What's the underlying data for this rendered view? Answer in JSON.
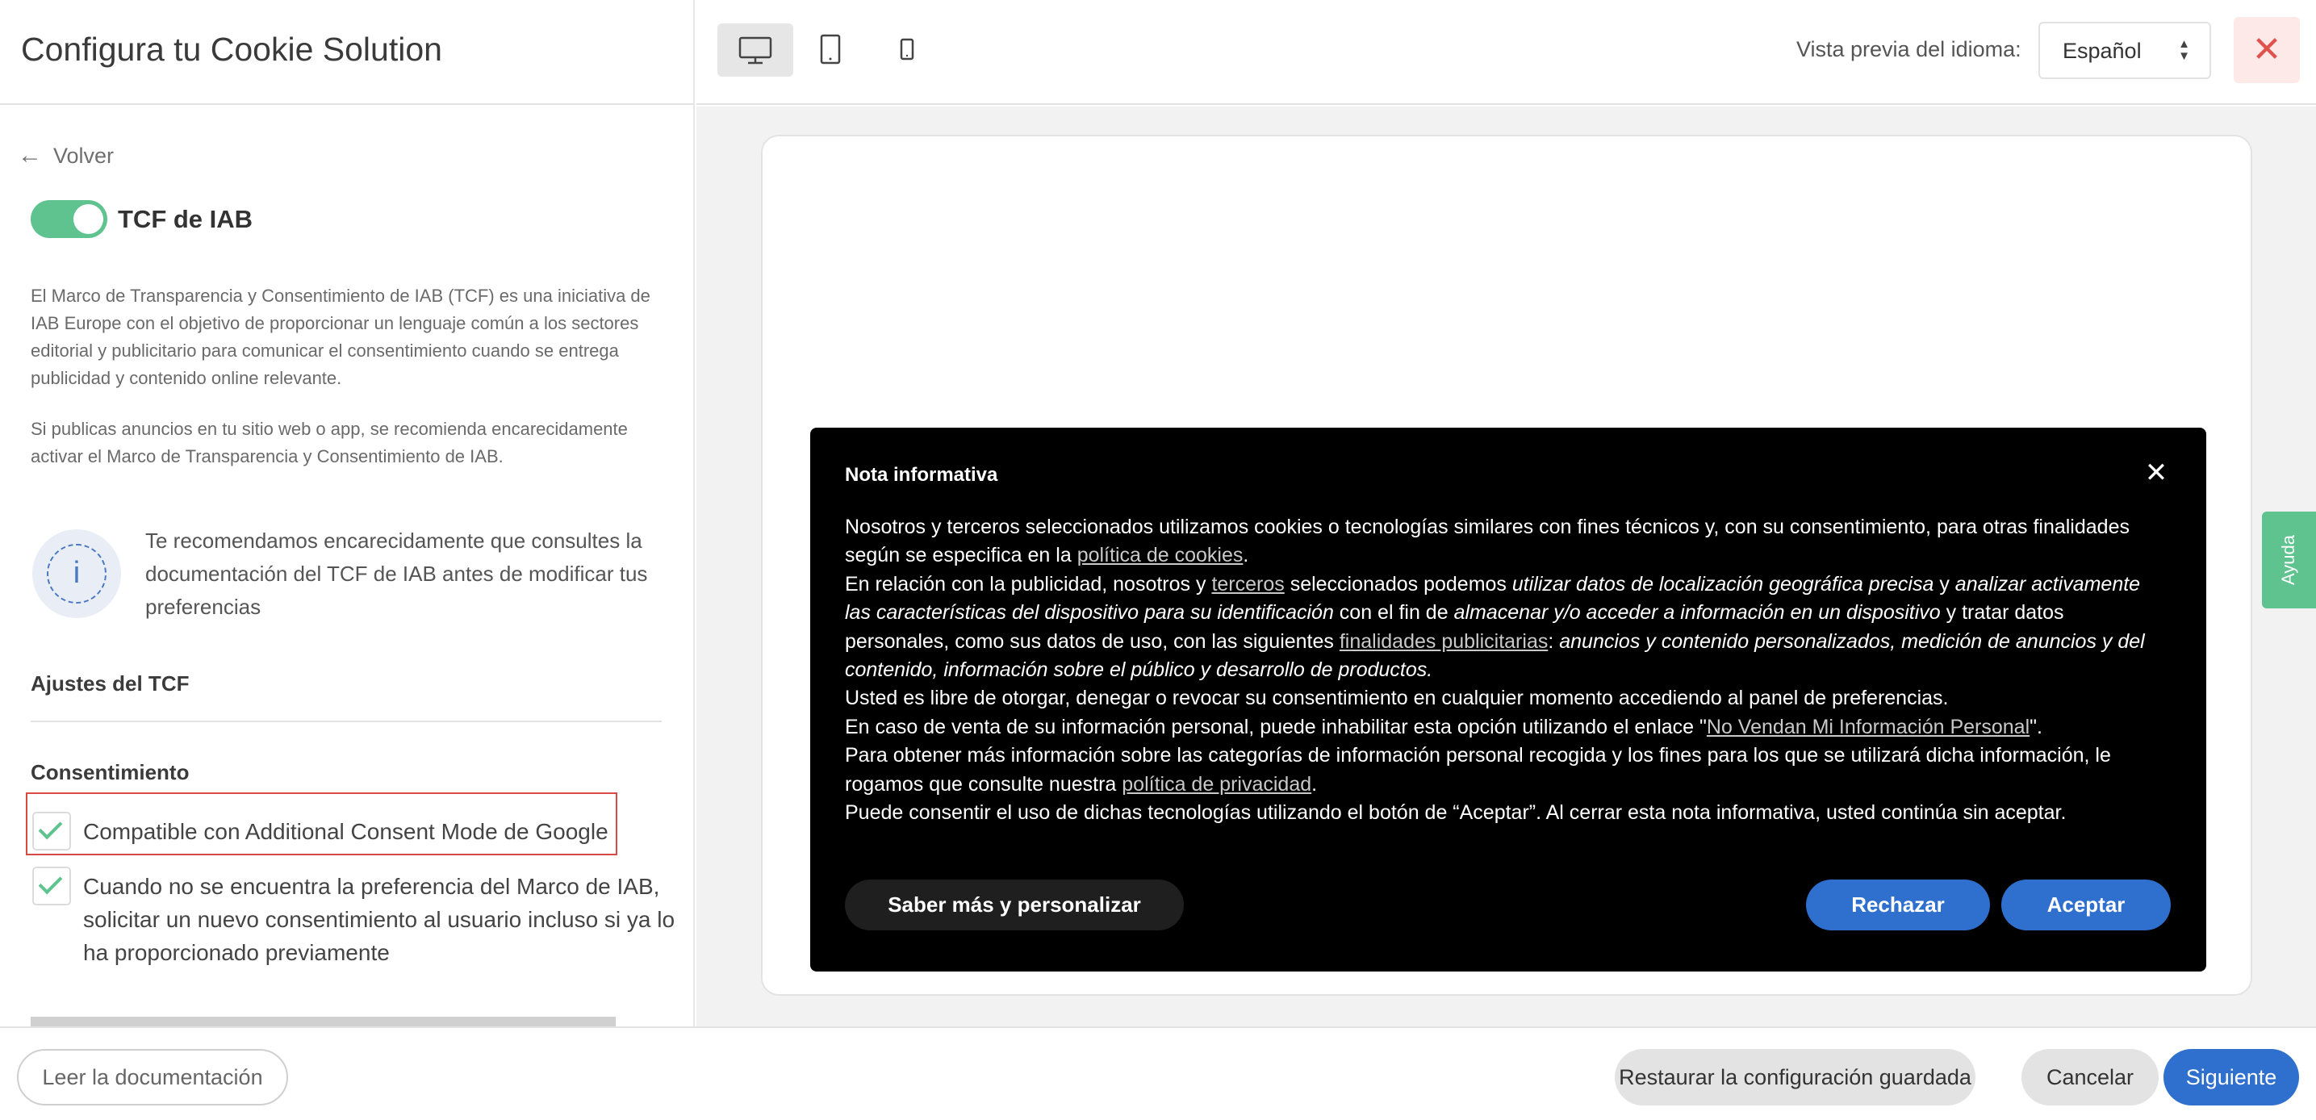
{
  "header": {
    "title": "Configura tu Cookie Solution"
  },
  "sidebar": {
    "back_label": "Volver",
    "tcf_toggle": {
      "on": true,
      "label": "TCF de IAB"
    },
    "description_1": "El Marco de Transparencia y Consentimiento de IAB (TCF) es una iniciativa de IAB Europe con el objetivo de proporcionar un lenguaje común a los sectores editorial y publicitario para comunicar el consentimiento cuando se entrega publicidad y contenido online relevante.",
    "description_2": "Si publicas anuncios en tu sitio web o app, se recomienda encarecidamente activar el Marco de Transparencia y Consentimiento de IAB.",
    "info_text": "Te recomendamos encarecidamente que consultes la documentación del TCF de IAB antes de modificar tus preferencias",
    "settings_heading": "Ajustes del TCF",
    "consent_heading": "Consentimiento",
    "checkboxes": [
      {
        "label": "Compatible con Additional Consent Mode de Google",
        "checked": true
      },
      {
        "label": "Cuando no se encuentra la preferencia del Marco de IAB, solicitar un nuevo consentimiento al usuario incluso si ya lo ha proporcionado previamente",
        "checked": true
      }
    ]
  },
  "toolbar": {
    "devices": [
      "desktop",
      "tablet",
      "mobile"
    ],
    "active_device": "desktop",
    "language_label": "Vista previa del idioma:",
    "language_value": "Español"
  },
  "banner": {
    "title": "Nota informativa",
    "p1_a": "Nosotros y terceros seleccionados utilizamos cookies o tecnologías similares con fines técnicos y, con su consentimiento, para otras finalidades según se especifica en la ",
    "p1_link": "política de cookies",
    "p1_b": ".",
    "p2_a": "En relación con la publicidad, nosotros y ",
    "p2_link1": "terceros",
    "p2_b": " seleccionados podemos ",
    "p2_em1": "utilizar datos de localización geográfica precisa",
    "p2_c": " y ",
    "p2_em2": "analizar activamente las características del dispositivo para su identificación",
    "p2_d": " con el fin de ",
    "p2_em3": "almacenar y/o acceder a información en un dispositivo",
    "p2_e": " y tratar datos personales, como sus datos de uso, con las siguientes ",
    "p2_link2": "finalidades publicitarias",
    "p2_f": ": ",
    "p2_em4": "anuncios y contenido personalizados, medición de anuncios y del contenido, información sobre el público y desarrollo de productos.",
    "p3": "Usted es libre de otorgar, denegar o revocar su consentimiento en cualquier momento accediendo al panel de preferencias.",
    "p4_a": "En caso de venta de su información personal, puede inhabilitar esta opción utilizando el enlace \"",
    "p4_link": "No Vendan Mi Información Personal",
    "p4_b": "\".",
    "p5_a": "Para obtener más información sobre las categorías de información personal recogida y los fines para los que se utilizará dicha información, le rogamos que consulte nuestra ",
    "p5_link": "política de privacidad",
    "p5_b": ".",
    "p6": "Puede consentir el uso de dichas tecnologías utilizando el botón de “Aceptar”. Al cerrar esta nota informativa, usted continúa sin aceptar.",
    "learn_more_label": "Saber más y personalizar",
    "reject_label": "Rechazar",
    "accept_label": "Aceptar"
  },
  "help_tab": {
    "label": "Ayuda"
  },
  "footer": {
    "docs_label": "Leer la documentación",
    "restore_label": "Restaurar la configuración guardada",
    "cancel_label": "Cancelar",
    "next_label": "Siguiente"
  },
  "colors": {
    "accent_green": "#5ec38e",
    "primary_blue": "#2f6fce",
    "close_red": "#e0524c",
    "banner_bg": "#000000"
  }
}
